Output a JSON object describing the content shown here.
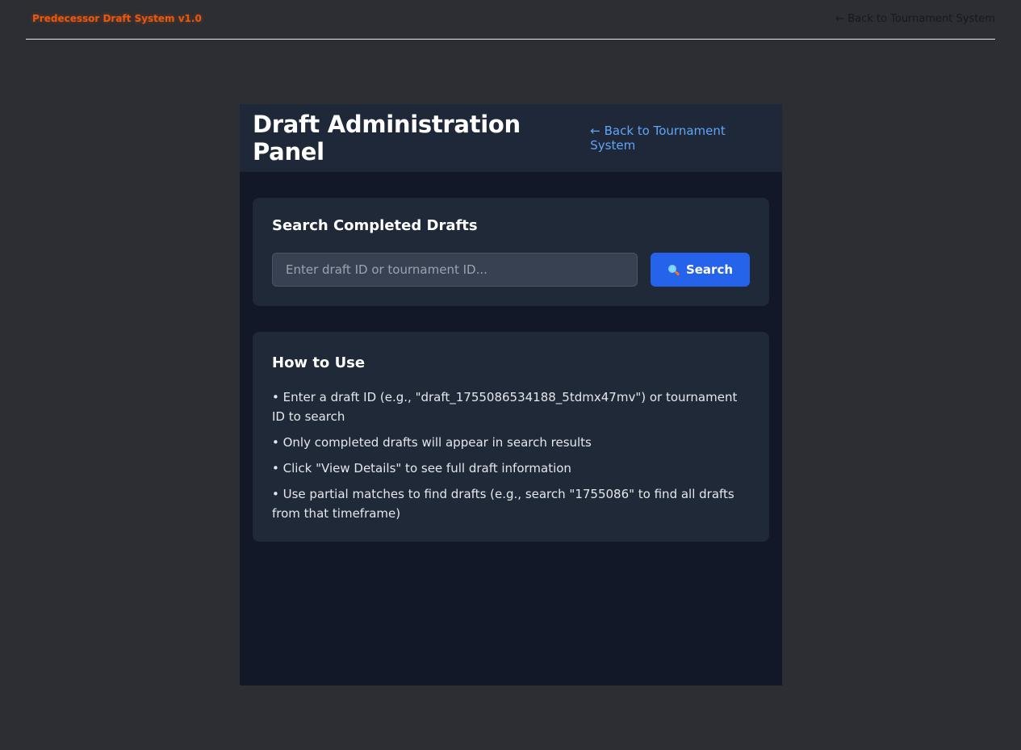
{
  "topbar": {
    "brand": "Predecessor Draft System v1.0",
    "back_link": "← Back to Tournament System"
  },
  "panel": {
    "title": "Draft Administration Panel",
    "back_link": "← Back to Tournament System"
  },
  "search": {
    "title": "Search Completed Drafts",
    "placeholder": "Enter draft ID or tournament ID...",
    "value": "",
    "button_label": "Search",
    "button_icon": "magnifying-glass-icon"
  },
  "help": {
    "title": "How to Use",
    "items": [
      "• Enter a draft ID (e.g., \"draft_1755086534188_5tdmx47mv\") or tournament ID to search",
      "• Only completed drafts will appear in search results",
      "• Click \"View Details\" to see full draft information",
      "• Use partial matches to find drafts (e.g., search \"1755086\" to find all drafts from that timeframe)"
    ]
  },
  "colors": {
    "page_bg": "#2c2e33",
    "panel_bg": "#121827",
    "header_bg": "#1e2838",
    "card_bg": "#1f2937",
    "accent_blue": "#2563eb",
    "link_blue": "#60a5fa",
    "brand_orange": "#ea580c"
  }
}
